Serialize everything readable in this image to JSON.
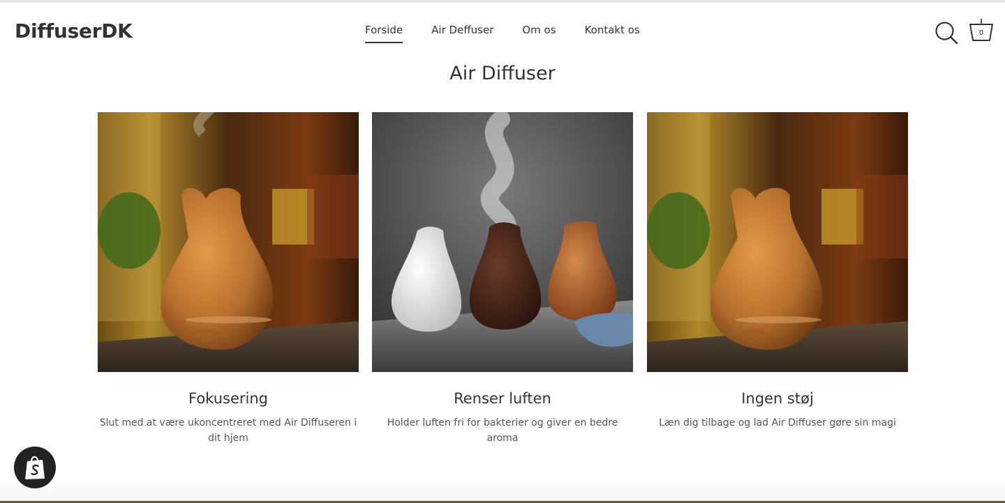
{
  "header": {
    "logo": "DiffuserDK",
    "nav": [
      "Forside",
      "Air Deffuser",
      "Om os",
      "Kontakt os"
    ],
    "active_nav": "Forside",
    "search_icon": "search-icon",
    "cart_icon": "cart-icon",
    "cart_count": "0"
  },
  "section": {
    "title": "Air Diffuser",
    "cards": [
      {
        "title": "Fokusering",
        "text": "Slut med at være ukoncentreret med Air Diffuseren i dit hjem",
        "image": "wood-vase-diffuser-photo"
      },
      {
        "title": "Renser luften",
        "text": "Holder luften fri for bakterier og giver en bedre aroma",
        "image": "three-diffusers-photo"
      },
      {
        "title": "Ingen støj",
        "text": "Læn dig tilbage og lad Air Diffuser gøre sin magi",
        "image": "wood-vase-diffuser-photo"
      }
    ]
  },
  "badge": {
    "icon": "shopify-bag-icon"
  },
  "colors": {
    "text": "#333333",
    "wood": "#b8702e",
    "accent_bar": "#6b5a3a"
  }
}
